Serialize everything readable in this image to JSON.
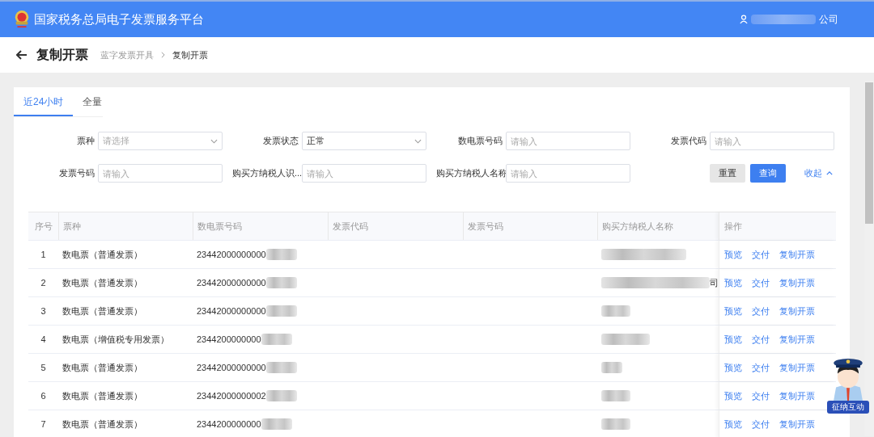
{
  "header": {
    "title": "国家税务总局电子发票服务平台",
    "user_suffix": "公司"
  },
  "page": {
    "title": "复制开票",
    "breadcrumb": [
      {
        "label": "蓝字发票开具",
        "current": false
      },
      {
        "label": "复制开票",
        "current": true
      }
    ]
  },
  "tabs": [
    {
      "label": "近24小时",
      "selected": true
    },
    {
      "label": "全量",
      "selected": false
    }
  ],
  "filters": [
    {
      "label": "票种",
      "kind": "select",
      "placeholder": "请选择"
    },
    {
      "label": "发票状态",
      "kind": "select",
      "value": "正常"
    },
    {
      "label": "数电票号码",
      "kind": "input",
      "placeholder": "请输入"
    },
    {
      "label": "发票代码",
      "kind": "input",
      "placeholder": "请输入"
    },
    {
      "label": "发票号码",
      "kind": "input",
      "placeholder": "请输入"
    },
    {
      "label": "购买方纳税人识...",
      "kind": "input",
      "placeholder": "请输入"
    },
    {
      "label": "购买方纳税人名称",
      "kind": "input",
      "placeholder": "请输入"
    }
  ],
  "actions": {
    "reset": "重置",
    "search": "查询",
    "collapse": "收起"
  },
  "table": {
    "columns": [
      "序号",
      "票种",
      "数电票号码",
      "发票代码",
      "发票号码",
      "购买方纳税人名称",
      "操作"
    ],
    "rows": [
      {
        "index": "1",
        "type": "数电票（普通发票）",
        "number": "23442000000000",
        "buyer_suffix": "",
        "ops": [
          "预览",
          "交付",
          "复制开票"
        ]
      },
      {
        "index": "2",
        "type": "数电票（普通发票）",
        "number": "23442000000000",
        "buyer_suffix": "司",
        "ops": [
          "预览",
          "交付",
          "复制开票"
        ]
      },
      {
        "index": "3",
        "type": "数电票（普通发票）",
        "number": "23442000000000",
        "buyer_suffix": "",
        "ops": [
          "预览",
          "交付",
          "复制开票"
        ]
      },
      {
        "index": "4",
        "type": "数电票（增值税专用发票）",
        "number": "2344200000000",
        "buyer_suffix": "",
        "ops": [
          "预览",
          "交付",
          "复制开票"
        ]
      },
      {
        "index": "5",
        "type": "数电票（普通发票）",
        "number": "23442000000000",
        "buyer_suffix": "",
        "ops": [
          "预览",
          "交付",
          "复制开票"
        ]
      },
      {
        "index": "6",
        "type": "数电票（普通发票）",
        "number": "23442000000002",
        "buyer_suffix": "",
        "ops": [
          "预览",
          "交付",
          "复制开票"
        ]
      },
      {
        "index": "7",
        "type": "数电票（普通发票）",
        "number": "2344200000000",
        "buyer_suffix": "",
        "ops": [
          "预览",
          "交付",
          "复制开票"
        ]
      }
    ]
  },
  "assistant": {
    "badge": "征纳互动"
  }
}
